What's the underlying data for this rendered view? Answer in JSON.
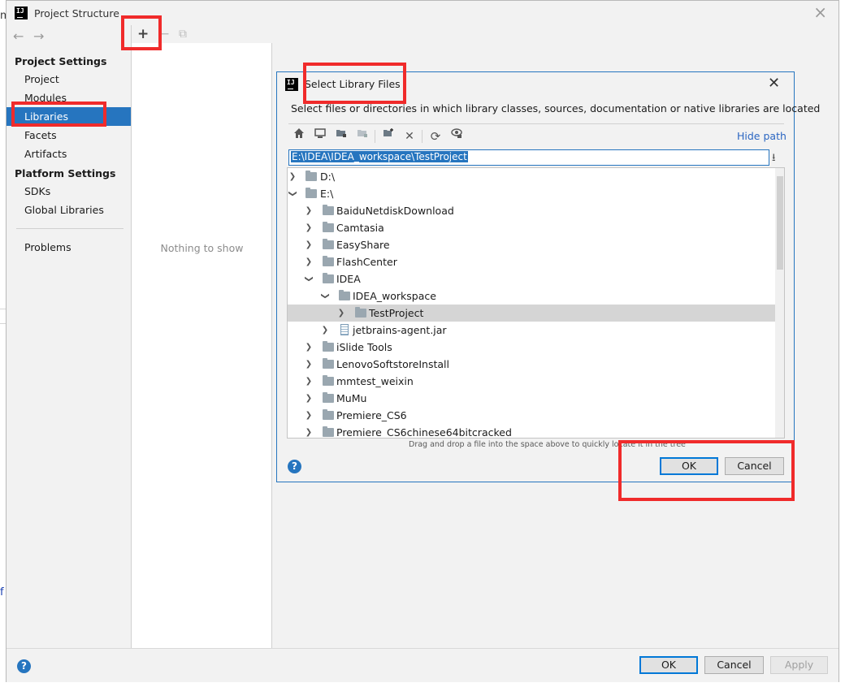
{
  "window": {
    "title": "Project Structure",
    "close_glyph": "×"
  },
  "nav": {
    "back_glyph": "←",
    "forward_glyph": "→",
    "project_settings_heading": "Project Settings",
    "project_settings_items": [
      "Project",
      "Modules",
      "Libraries",
      "Facets",
      "Artifacts"
    ],
    "selected_item": "Libraries",
    "platform_settings_heading": "Platform Settings",
    "platform_settings_items": [
      "SDKs",
      "Global Libraries"
    ],
    "other_items": [
      "Problems"
    ]
  },
  "middle": {
    "toolbar": {
      "add_glyph": "+",
      "remove_glyph": "−",
      "copy_glyph": "⧉"
    },
    "empty_text": "Nothing to show"
  },
  "dialog": {
    "title": "Select Library Files",
    "close_glyph": "✕",
    "description": "Select files or directories in which library classes, sources, documentation or native libraries are located",
    "toolbar_icons": [
      "home-icon",
      "desktop-icon",
      "project-folder-icon",
      "module-folder-icon",
      "new-folder-icon",
      "delete-icon",
      "refresh-icon",
      "show-hidden-icon"
    ],
    "hide_path_label": "Hide path",
    "path_value": "E:\\IDEA\\IDEA_workspace\\TestProject",
    "tree": {
      "drive_d": "D:\\",
      "drive_e": "E:\\",
      "folders_top": [
        "BaiduNetdiskDownload",
        "Camtasia",
        "EasyShare",
        "FlashCenter"
      ],
      "idea": "IDEA",
      "idea_workspace": "IDEA_workspace",
      "test_project": "TestProject",
      "jetbrains_jar": "jetbrains-agent.jar",
      "folders_bottom": [
        "iSlide Tools",
        "LenovoSoftstoreInstall",
        "mmtest_weixin",
        "MuMu",
        "Premiere_CS6",
        "Premiere_CS6chinese64bitcracked"
      ]
    },
    "drag_hint": "Drag and drop a file into the space above to quickly locate it in the tree",
    "ok_label": "OK",
    "cancel_label": "Cancel",
    "help_glyph": "?"
  },
  "bottom": {
    "help_glyph": "?",
    "ok_label": "OK",
    "cancel_label": "Cancel",
    "apply_label": "Apply"
  },
  "background_fragments": [
    "m",
    "f"
  ],
  "colors": {
    "selection_blue": "#2675bf",
    "highlight_red": "#f02b2b",
    "tree_selection_gray": "#d5d5d5"
  }
}
